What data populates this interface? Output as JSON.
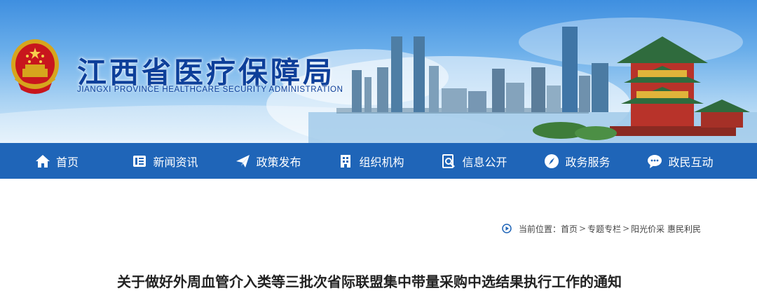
{
  "header": {
    "title_cn": "江西省医疗保障局",
    "title_en": "JIANGXI PROVINCE HEALTHCARE SECURITY ADMINISTRATION"
  },
  "nav": {
    "items": [
      {
        "label": "首页",
        "icon": "home-icon"
      },
      {
        "label": "新闻资讯",
        "icon": "news-icon"
      },
      {
        "label": "政策发布",
        "icon": "paper-plane-icon"
      },
      {
        "label": "组织机构",
        "icon": "building-icon"
      },
      {
        "label": "信息公开",
        "icon": "search-document-icon"
      },
      {
        "label": "政务服务",
        "icon": "compass-icon"
      },
      {
        "label": "政民互动",
        "icon": "chat-icon"
      }
    ]
  },
  "breadcrumb": {
    "prefix": "当前位置：",
    "items": [
      "首页",
      "专题专栏",
      "阳光价采 惠民利民"
    ],
    "separator": ">"
  },
  "article": {
    "title": "关于做好外周血管介入类等三批次省际联盟集中带量采购中选结果执行工作的通知"
  },
  "colors": {
    "nav_bg": "#1f65b8",
    "title_blue": "#0d3f9a"
  }
}
